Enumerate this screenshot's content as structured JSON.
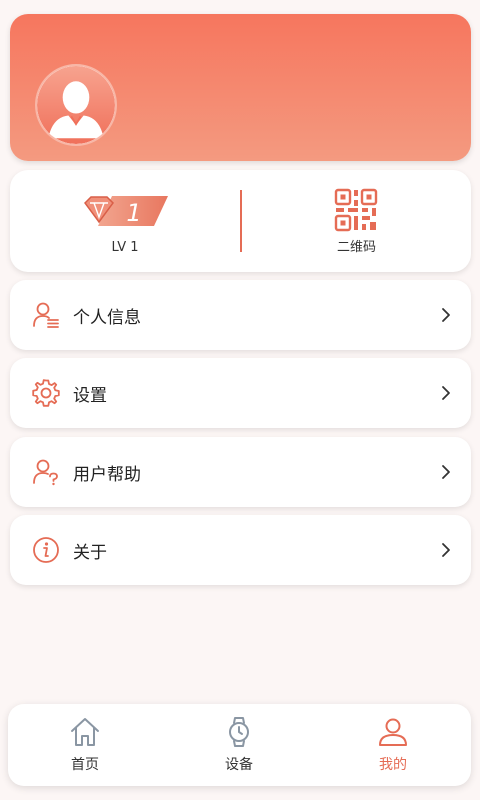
{
  "colors": {
    "accent": "#e56c55",
    "header_gradient_top": "#f6765e",
    "header_gradient_bottom": "#f49a80",
    "page_background": "#fcf6f5",
    "inactive_icon": "#8a96a3"
  },
  "profile": {
    "avatar_icon": "user-avatar-icon"
  },
  "stats": {
    "level_badge_number": "1",
    "level_label": "LV 1",
    "qr_label": "二维码"
  },
  "menu": [
    {
      "label": "个人信息",
      "icon": "person-info-icon"
    },
    {
      "label": "设置",
      "icon": "gear-icon"
    },
    {
      "label": "用户帮助",
      "icon": "user-help-icon"
    },
    {
      "label": "关于",
      "icon": "info-icon"
    }
  ],
  "tabbar": {
    "tabs": [
      {
        "label": "首页",
        "icon": "home-icon",
        "active": false
      },
      {
        "label": "设备",
        "icon": "watch-icon",
        "active": false
      },
      {
        "label": "我的",
        "icon": "profile-icon",
        "active": true
      }
    ]
  }
}
